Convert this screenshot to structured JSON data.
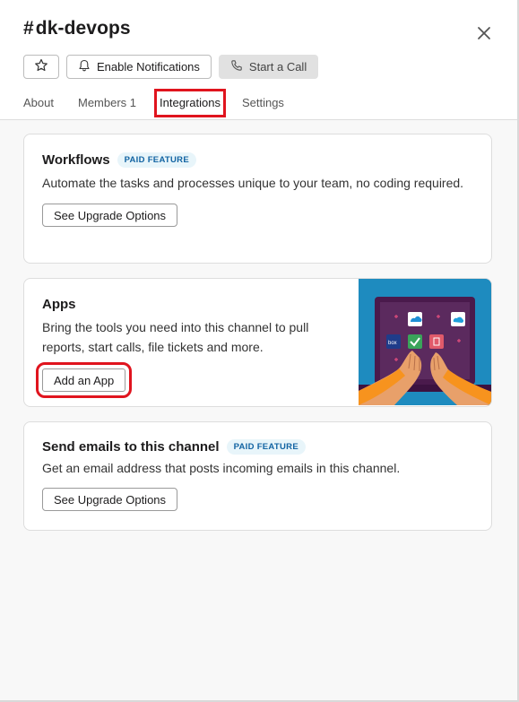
{
  "channel": {
    "hash": "#",
    "name": "dk-devops"
  },
  "actions": {
    "enable_notifications": "Enable Notifications",
    "start_call": "Start a Call"
  },
  "tabs": [
    {
      "label": "About"
    },
    {
      "label": "Members 1"
    },
    {
      "label": "Integrations"
    },
    {
      "label": "Settings"
    }
  ],
  "workflows": {
    "title": "Workflows",
    "badge": "PAID FEATURE",
    "description": "Automate the tasks and processes unique to your team, no coding required.",
    "button": "See Upgrade Options"
  },
  "apps": {
    "title": "Apps",
    "description": "Bring the tools you need into this channel to pull reports, start calls, file tickets and more.",
    "button": "Add an App",
    "illustration_tile_label": "box"
  },
  "emails": {
    "title": "Send emails to this channel",
    "badge": "PAID FEATURE",
    "description": "Get an email address that posts incoming emails in this channel.",
    "button": "See Upgrade Options"
  },
  "colors": {
    "highlight": "#e0141e",
    "badge_text": "#1264a3",
    "badge_bg": "#e8f5fa",
    "illustration_bg": "#1e8bbf",
    "laptop": "#4a1a4c"
  },
  "icons": [
    "star-icon",
    "bell-icon",
    "phone-icon",
    "close-icon"
  ]
}
